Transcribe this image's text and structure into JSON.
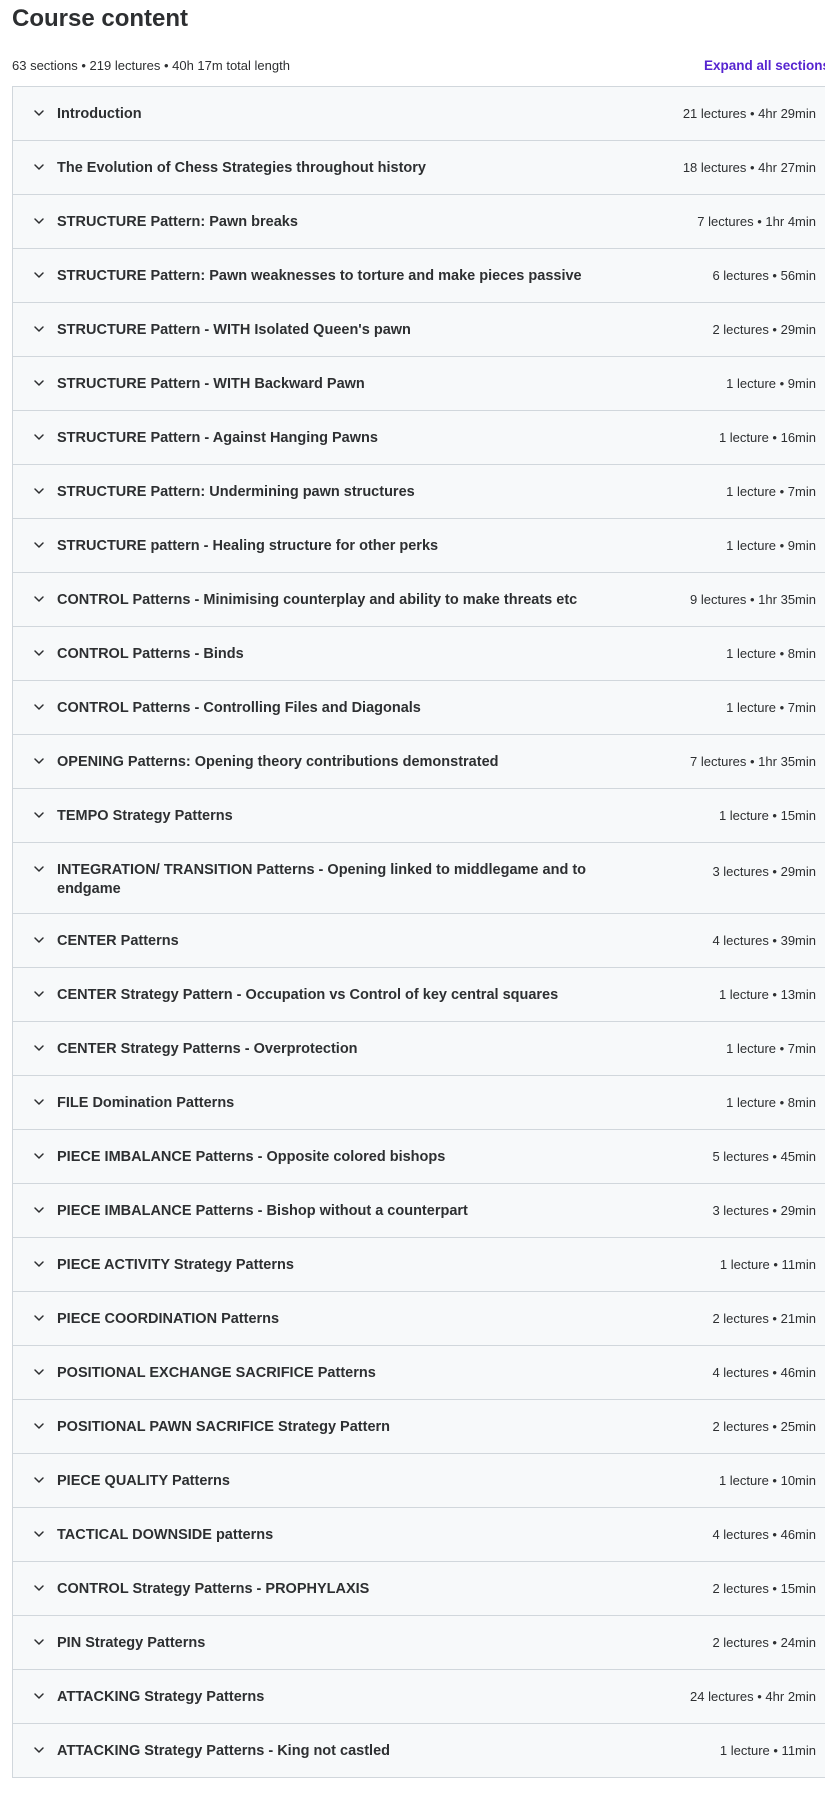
{
  "header": {
    "title": "Course content",
    "summary": "63 sections • 219 lectures • 40h 17m total length",
    "expand_all_label": "Expand all sections"
  },
  "icons": {
    "chevron": "chevron-down-icon"
  },
  "colors": {
    "accent": "#5624d0",
    "row_background": "#f7f9fa",
    "border": "#d1d7dc",
    "text": "#2d2f31"
  },
  "sections": [
    {
      "title": "Introduction",
      "meta": "21 lectures • 4hr 29min"
    },
    {
      "title": "The Evolution of Chess Strategies throughout history",
      "meta": "18 lectures • 4hr 27min"
    },
    {
      "title": "STRUCTURE Pattern: Pawn breaks",
      "meta": "7 lectures • 1hr 4min"
    },
    {
      "title": "STRUCTURE Pattern: Pawn weaknesses to torture and make pieces passive",
      "meta": "6 lectures • 56min"
    },
    {
      "title": "STRUCTURE Pattern - WITH Isolated Queen's pawn",
      "meta": "2 lectures • 29min"
    },
    {
      "title": "STRUCTURE Pattern - WITH Backward Pawn",
      "meta": "1 lecture • 9min"
    },
    {
      "title": "STRUCTURE Pattern - Against Hanging Pawns",
      "meta": "1 lecture • 16min"
    },
    {
      "title": "STRUCTURE Pattern: Undermining pawn structures",
      "meta": "1 lecture • 7min"
    },
    {
      "title": "STRUCTURE pattern - Healing structure for other perks",
      "meta": "1 lecture • 9min"
    },
    {
      "title": "CONTROL Patterns - Minimising counterplay and ability to make threats etc",
      "meta": "9 lectures • 1hr 35min"
    },
    {
      "title": "CONTROL Patterns - Binds",
      "meta": "1 lecture • 8min"
    },
    {
      "title": "CONTROL Patterns - Controlling Files and Diagonals",
      "meta": "1 lecture • 7min"
    },
    {
      "title": "OPENING Patterns: Opening theory contributions demonstrated",
      "meta": "7 lectures • 1hr 35min"
    },
    {
      "title": "TEMPO Strategy Patterns",
      "meta": "1 lecture • 15min"
    },
    {
      "title": "INTEGRATION/ TRANSITION Patterns - Opening linked to middlegame and to endgame",
      "meta": "3 lectures • 29min"
    },
    {
      "title": "CENTER Patterns",
      "meta": "4 lectures • 39min"
    },
    {
      "title": "CENTER Strategy Pattern - Occupation vs Control of key central squares",
      "meta": "1 lecture • 13min"
    },
    {
      "title": "CENTER Strategy Patterns - Overprotection",
      "meta": "1 lecture • 7min"
    },
    {
      "title": "FILE Domination Patterns",
      "meta": "1 lecture • 8min"
    },
    {
      "title": "PIECE IMBALANCE Patterns - Opposite colored bishops",
      "meta": "5 lectures • 45min"
    },
    {
      "title": "PIECE IMBALANCE Patterns - Bishop without a counterpart",
      "meta": "3 lectures • 29min"
    },
    {
      "title": "PIECE ACTIVITY Strategy Patterns",
      "meta": "1 lecture • 11min"
    },
    {
      "title": "PIECE COORDINATION Patterns",
      "meta": "2 lectures • 21min"
    },
    {
      "title": "POSITIONAL EXCHANGE SACRIFICE Patterns",
      "meta": "4 lectures • 46min"
    },
    {
      "title": "POSITIONAL PAWN SACRIFICE Strategy Pattern",
      "meta": "2 lectures • 25min"
    },
    {
      "title": "PIECE QUALITY Patterns",
      "meta": "1 lecture • 10min"
    },
    {
      "title": "TACTICAL DOWNSIDE patterns",
      "meta": "4 lectures • 46min"
    },
    {
      "title": "CONTROL Strategy Patterns - PROPHYLAXIS",
      "meta": "2 lectures • 15min"
    },
    {
      "title": "PIN Strategy Patterns",
      "meta": "2 lectures • 24min"
    },
    {
      "title": "ATTACKING Strategy Patterns",
      "meta": "24 lectures • 4hr 2min"
    },
    {
      "title": "ATTACKING Strategy Patterns - King not castled",
      "meta": "1 lecture • 11min"
    }
  ]
}
